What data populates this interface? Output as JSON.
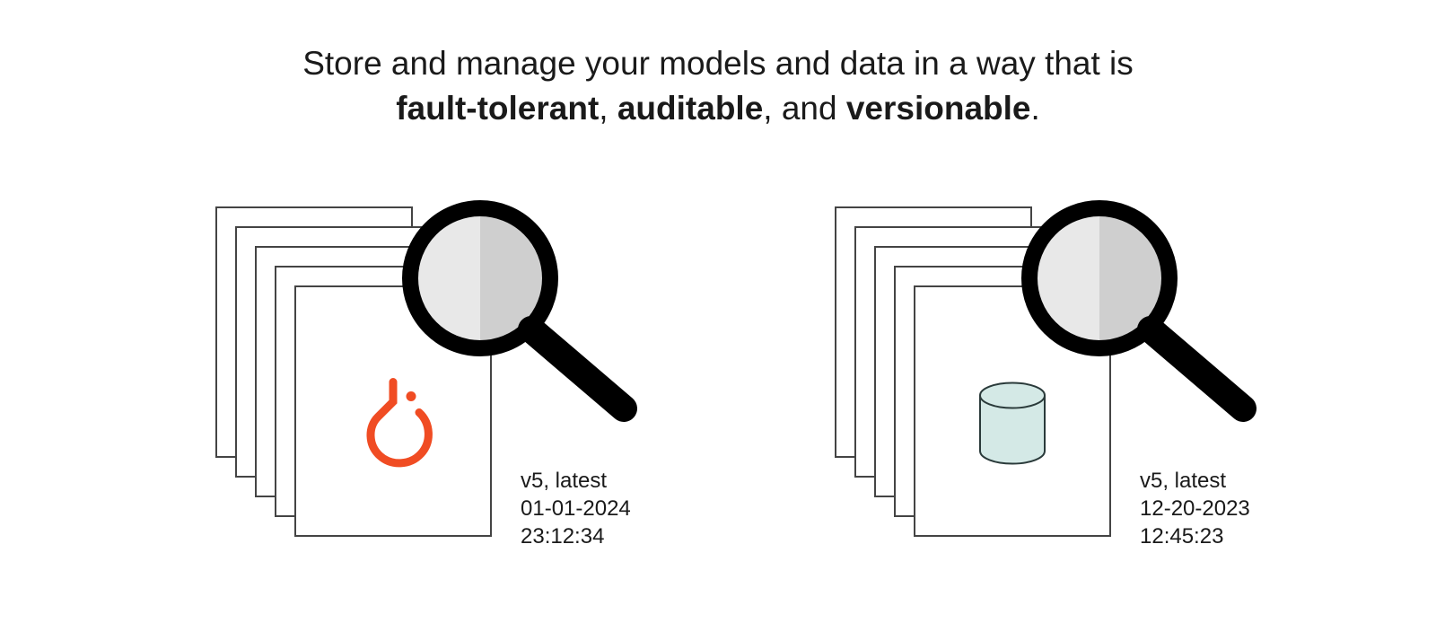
{
  "headline": {
    "prefix": "Store and manage your models and data in a way that is ",
    "kw1": "fault-tolerant",
    "sep1": ", ",
    "kw2": "auditable",
    "sep2": ", and ",
    "kw3": "versionable",
    "suffix": "."
  },
  "left": {
    "icon": "pytorch-icon",
    "version": "v5, latest",
    "date": "01-01-2024",
    "time": "23:12:34"
  },
  "right": {
    "icon": "database-cylinder-icon",
    "version": "v5, latest",
    "date": "12-20-2023",
    "time": "12:45:23"
  },
  "colors": {
    "accent_orange": "#f04c23",
    "cylinder_fill": "#d4e9e6",
    "lens_fill": "#cfcfcf",
    "lens_hi": "#e8e8e8"
  }
}
